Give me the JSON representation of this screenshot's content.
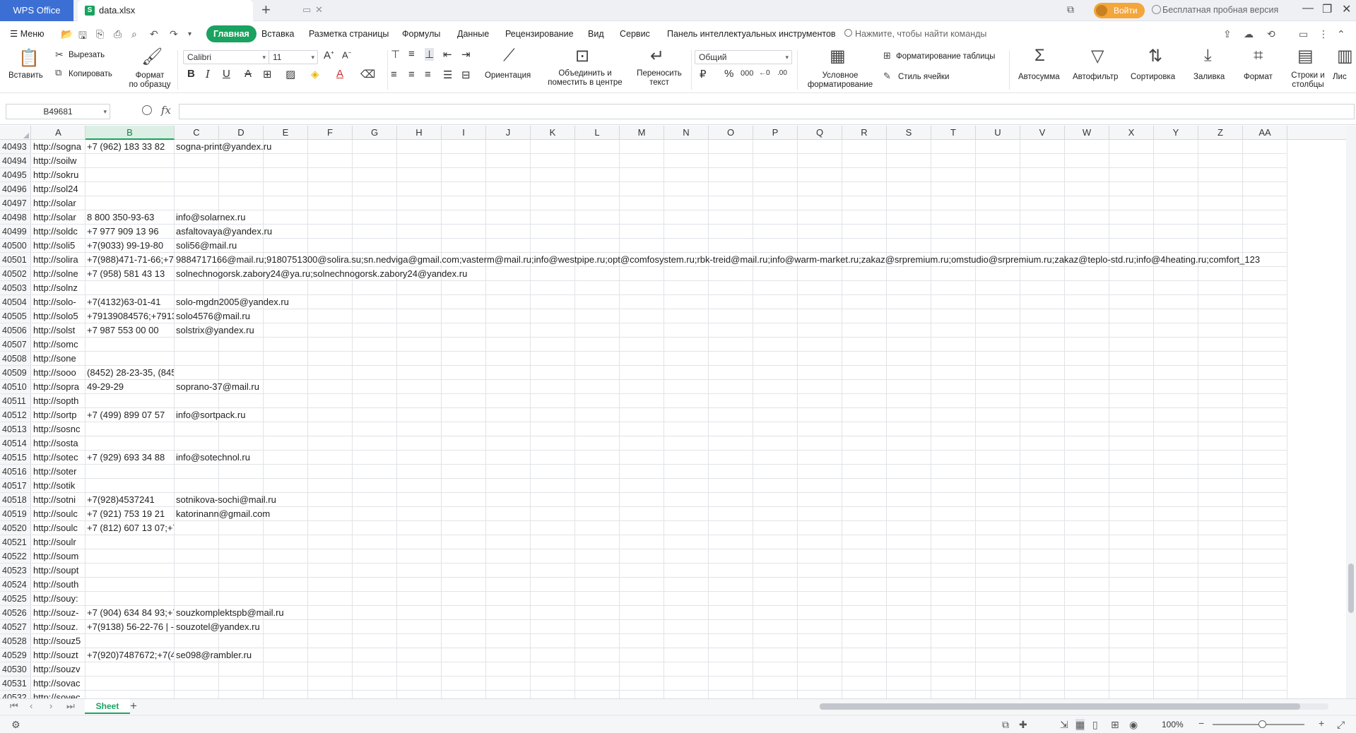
{
  "titlebar": {
    "app_tab": "WPS Office",
    "file_tab": "data.xlsx",
    "login": "Войти",
    "trial": "Бесплатная пробная версия"
  },
  "menubar": {
    "menu": "Меню",
    "tabs": [
      "Главная",
      "Вставка",
      "Разметка страницы",
      "Формулы",
      "Данные",
      "Рецензирование",
      "Вид",
      "Сервис",
      "Панель интеллектуальных инструментов"
    ],
    "active_tab": "Главная",
    "search": "Нажмите, чтобы найти команды"
  },
  "ribbon": {
    "paste": "Вставить",
    "cut": "Вырезать",
    "copy": "Копировать",
    "format_painter_1": "Формат",
    "format_painter_2": "по образцу",
    "font_name": "Calibri",
    "font_size": "11",
    "orientation": "Ориентация",
    "merge_1": "Объединить и",
    "merge_2": "поместить в центре",
    "wrap_1": "Переносить",
    "wrap_2": "текст",
    "number_format": "Общий",
    "cond_format_1": "Условное",
    "cond_format_2": "форматирование",
    "table_format": "Форматирование таблицы",
    "cell_style": "Стиль ячейки",
    "autosum": "Автосумма",
    "autofilter": "Автофильтр",
    "sort": "Сортировка",
    "fill": "Заливка",
    "format": "Формат",
    "rows_cols_1": "Строки и",
    "rows_cols_2": "столбцы",
    "list": "Лис"
  },
  "formula": {
    "namebox": "B49681",
    "fx": "fx",
    "value": ""
  },
  "columns": [
    "A",
    "B",
    "C",
    "D",
    "E",
    "F",
    "G",
    "H",
    "I",
    "J",
    "K",
    "L",
    "M",
    "N",
    "O",
    "P",
    "Q",
    "R",
    "S",
    "T",
    "U",
    "V",
    "W",
    "X",
    "Y",
    "Z",
    "AA"
  ],
  "selected_column": "B",
  "rows": [
    {
      "n": "40493",
      "a": "http://sogna",
      "b": "+7 (962) 183 33 82",
      "c": "sogna-print@yandex.ru"
    },
    {
      "n": "40494",
      "a": "http://soilw",
      "b": "",
      "c": ""
    },
    {
      "n": "40495",
      "a": "http://sokru",
      "b": "",
      "c": ""
    },
    {
      "n": "40496",
      "a": "http://sol24",
      "b": "",
      "c": ""
    },
    {
      "n": "40497",
      "a": "http://solar",
      "b": "",
      "c": ""
    },
    {
      "n": "40498",
      "a": "http://solar",
      "b": "8 800 350-93-63",
      "c": "info@solarnex.ru"
    },
    {
      "n": "40499",
      "a": "http://soldc",
      "b": "+7 977 909 13 96",
      "c": "asfaltovaya@yandex.ru"
    },
    {
      "n": "40500",
      "a": "http://soli5",
      "b": "+7(9033) 99-19-80",
      "c": "soli56@mail.ru"
    },
    {
      "n": "40501",
      "a": "http://solira",
      "b": "+7(988)471-71-66;+7",
      "c": "9884717166@mail.ru;9180751300@solira.su;sn.nedviga@gmail.com;vasterm@mail.ru;info@westpipe.ru;opt@comfosystem.ru;rbk-treid@mail.ru;info@warm-market.ru;zakaz@srpremium.ru;omstudio@srpremium.ru;zakaz@teplo-std.ru;info@4heating.ru;comfort_123"
    },
    {
      "n": "40502",
      "a": "http://solne",
      "b": "+7 (958) 581 43 13",
      "c": "solnechnogorsk.zabory24@ya.ru;solnechnogorsk.zabory24@yandex.ru"
    },
    {
      "n": "40503",
      "a": "http://solnz",
      "b": "",
      "c": ""
    },
    {
      "n": "40504",
      "a": "http://solo-",
      "b": "+7(4132)63-01-41",
      "c": "solo-mgdn2005@yandex.ru"
    },
    {
      "n": "40505",
      "a": "http://solo5",
      "b": "+79139084576;+7913",
      "c": "solo4576@mail.ru"
    },
    {
      "n": "40506",
      "a": "http://solst",
      "b": "+7 987 553 00 00",
      "c": "solstrix@yandex.ru"
    },
    {
      "n": "40507",
      "a": "http://somc",
      "b": "",
      "c": ""
    },
    {
      "n": "40508",
      "a": "http://sone",
      "b": "",
      "c": ""
    },
    {
      "n": "40509",
      "a": "http://sooo",
      "b": "(8452) 28-23-35, (845",
      "c": ""
    },
    {
      "n": "40510",
      "a": "http://sopra",
      "b": "49-29-29",
      "c": "soprano-37@mail.ru"
    },
    {
      "n": "40511",
      "a": "http://sopth",
      "b": "",
      "c": ""
    },
    {
      "n": "40512",
      "a": "http://sortp",
      "b": "+7 (499) 899 07 57",
      "c": "info@sortpack.ru"
    },
    {
      "n": "40513",
      "a": "http://sosnc",
      "b": "",
      "c": ""
    },
    {
      "n": "40514",
      "a": "http://sosta",
      "b": "",
      "c": ""
    },
    {
      "n": "40515",
      "a": "http://sotec",
      "b": "+7 (929) 693 34 88",
      "c": "info@sotechnol.ru"
    },
    {
      "n": "40516",
      "a": "http://soter",
      "b": "",
      "c": ""
    },
    {
      "n": "40517",
      "a": "http://sotik",
      "b": "",
      "c": ""
    },
    {
      "n": "40518",
      "a": "http://sotni",
      "b": "+7(928)4537241",
      "c": "sotnikova-sochi@mail.ru"
    },
    {
      "n": "40519",
      "a": "http://soulc",
      "b": "+7 (921) 753 19 21",
      "c": "katorinann@gmail.com"
    },
    {
      "n": "40520",
      "a": "http://soulc",
      "b": "+7 (812) 607 13 07;+7",
      "c": ""
    },
    {
      "n": "40521",
      "a": "http://soulr",
      "b": "",
      "c": ""
    },
    {
      "n": "40522",
      "a": "http://soum",
      "b": "",
      "c": ""
    },
    {
      "n": "40523",
      "a": "http://soupt",
      "b": "",
      "c": ""
    },
    {
      "n": "40524",
      "a": "http://south",
      "b": "",
      "c": ""
    },
    {
      "n": "40525",
      "a": "http://souy:",
      "b": "",
      "c": ""
    },
    {
      "n": "40526",
      "a": "http://souz-",
      "b": "+7 (904) 634 84 93;+7",
      "c": "souzkomplektspb@mail.ru"
    },
    {
      "n": "40527",
      "a": "http://souz.",
      "b": "+7(9138) 56-22-76 | -",
      "c": "souzotel@yandex.ru"
    },
    {
      "n": "40528",
      "a": "http://souz5",
      "b": "",
      "c": ""
    },
    {
      "n": "40529",
      "a": "http://souzt",
      "b": "+7(920)7487672;+7(4",
      "c": "se098@rambler.ru"
    },
    {
      "n": "40530",
      "a": "http://souzv",
      "b": "",
      "c": ""
    },
    {
      "n": "40531",
      "a": "http://sovac",
      "b": "",
      "c": ""
    },
    {
      "n": "40532",
      "a": "http://sovec",
      "b": "",
      "c": ""
    }
  ],
  "sheet": {
    "name": "Sheet"
  },
  "status": {
    "zoom": "100%"
  }
}
